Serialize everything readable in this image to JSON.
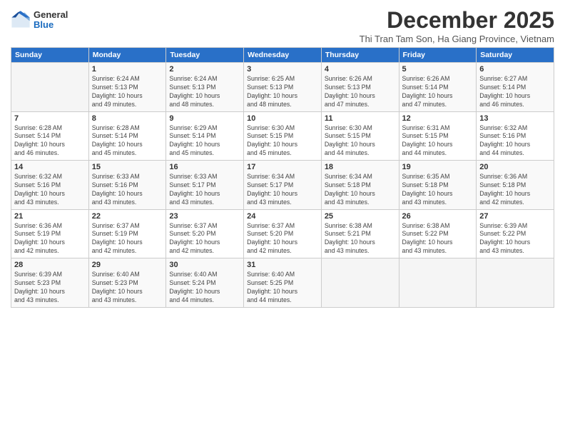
{
  "header": {
    "logo_general": "General",
    "logo_blue": "Blue",
    "month_title": "December 2025",
    "subtitle": "Thi Tran Tam Son, Ha Giang Province, Vietnam"
  },
  "days_of_week": [
    "Sunday",
    "Monday",
    "Tuesday",
    "Wednesday",
    "Thursday",
    "Friday",
    "Saturday"
  ],
  "weeks": [
    [
      {
        "day": "",
        "info": ""
      },
      {
        "day": "1",
        "info": "Sunrise: 6:24 AM\nSunset: 5:13 PM\nDaylight: 10 hours\nand 49 minutes."
      },
      {
        "day": "2",
        "info": "Sunrise: 6:24 AM\nSunset: 5:13 PM\nDaylight: 10 hours\nand 48 minutes."
      },
      {
        "day": "3",
        "info": "Sunrise: 6:25 AM\nSunset: 5:13 PM\nDaylight: 10 hours\nand 48 minutes."
      },
      {
        "day": "4",
        "info": "Sunrise: 6:26 AM\nSunset: 5:13 PM\nDaylight: 10 hours\nand 47 minutes."
      },
      {
        "day": "5",
        "info": "Sunrise: 6:26 AM\nSunset: 5:14 PM\nDaylight: 10 hours\nand 47 minutes."
      },
      {
        "day": "6",
        "info": "Sunrise: 6:27 AM\nSunset: 5:14 PM\nDaylight: 10 hours\nand 46 minutes."
      }
    ],
    [
      {
        "day": "7",
        "info": "Sunrise: 6:28 AM\nSunset: 5:14 PM\nDaylight: 10 hours\nand 46 minutes."
      },
      {
        "day": "8",
        "info": "Sunrise: 6:28 AM\nSunset: 5:14 PM\nDaylight: 10 hours\nand 45 minutes."
      },
      {
        "day": "9",
        "info": "Sunrise: 6:29 AM\nSunset: 5:14 PM\nDaylight: 10 hours\nand 45 minutes."
      },
      {
        "day": "10",
        "info": "Sunrise: 6:30 AM\nSunset: 5:15 PM\nDaylight: 10 hours\nand 45 minutes."
      },
      {
        "day": "11",
        "info": "Sunrise: 6:30 AM\nSunset: 5:15 PM\nDaylight: 10 hours\nand 44 minutes."
      },
      {
        "day": "12",
        "info": "Sunrise: 6:31 AM\nSunset: 5:15 PM\nDaylight: 10 hours\nand 44 minutes."
      },
      {
        "day": "13",
        "info": "Sunrise: 6:32 AM\nSunset: 5:16 PM\nDaylight: 10 hours\nand 44 minutes."
      }
    ],
    [
      {
        "day": "14",
        "info": "Sunrise: 6:32 AM\nSunset: 5:16 PM\nDaylight: 10 hours\nand 43 minutes."
      },
      {
        "day": "15",
        "info": "Sunrise: 6:33 AM\nSunset: 5:16 PM\nDaylight: 10 hours\nand 43 minutes."
      },
      {
        "day": "16",
        "info": "Sunrise: 6:33 AM\nSunset: 5:17 PM\nDaylight: 10 hours\nand 43 minutes."
      },
      {
        "day": "17",
        "info": "Sunrise: 6:34 AM\nSunset: 5:17 PM\nDaylight: 10 hours\nand 43 minutes."
      },
      {
        "day": "18",
        "info": "Sunrise: 6:34 AM\nSunset: 5:18 PM\nDaylight: 10 hours\nand 43 minutes."
      },
      {
        "day": "19",
        "info": "Sunrise: 6:35 AM\nSunset: 5:18 PM\nDaylight: 10 hours\nand 43 minutes."
      },
      {
        "day": "20",
        "info": "Sunrise: 6:36 AM\nSunset: 5:18 PM\nDaylight: 10 hours\nand 42 minutes."
      }
    ],
    [
      {
        "day": "21",
        "info": "Sunrise: 6:36 AM\nSunset: 5:19 PM\nDaylight: 10 hours\nand 42 minutes."
      },
      {
        "day": "22",
        "info": "Sunrise: 6:37 AM\nSunset: 5:19 PM\nDaylight: 10 hours\nand 42 minutes."
      },
      {
        "day": "23",
        "info": "Sunrise: 6:37 AM\nSunset: 5:20 PM\nDaylight: 10 hours\nand 42 minutes."
      },
      {
        "day": "24",
        "info": "Sunrise: 6:37 AM\nSunset: 5:20 PM\nDaylight: 10 hours\nand 42 minutes."
      },
      {
        "day": "25",
        "info": "Sunrise: 6:38 AM\nSunset: 5:21 PM\nDaylight: 10 hours\nand 43 minutes."
      },
      {
        "day": "26",
        "info": "Sunrise: 6:38 AM\nSunset: 5:22 PM\nDaylight: 10 hours\nand 43 minutes."
      },
      {
        "day": "27",
        "info": "Sunrise: 6:39 AM\nSunset: 5:22 PM\nDaylight: 10 hours\nand 43 minutes."
      }
    ],
    [
      {
        "day": "28",
        "info": "Sunrise: 6:39 AM\nSunset: 5:23 PM\nDaylight: 10 hours\nand 43 minutes."
      },
      {
        "day": "29",
        "info": "Sunrise: 6:40 AM\nSunset: 5:23 PM\nDaylight: 10 hours\nand 43 minutes."
      },
      {
        "day": "30",
        "info": "Sunrise: 6:40 AM\nSunset: 5:24 PM\nDaylight: 10 hours\nand 44 minutes."
      },
      {
        "day": "31",
        "info": "Sunrise: 6:40 AM\nSunset: 5:25 PM\nDaylight: 10 hours\nand 44 minutes."
      },
      {
        "day": "",
        "info": ""
      },
      {
        "day": "",
        "info": ""
      },
      {
        "day": "",
        "info": ""
      }
    ]
  ]
}
